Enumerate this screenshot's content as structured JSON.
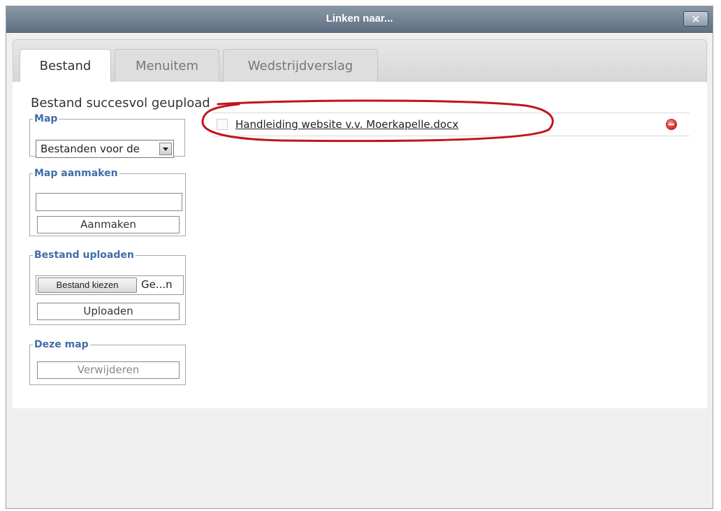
{
  "dialog": {
    "title": "Linken naar...",
    "close_glyph": "✕"
  },
  "tabs": [
    {
      "label": "Bestand",
      "active": true
    },
    {
      "label": "Menuitem",
      "active": false
    },
    {
      "label": "Wedstrijdverslag",
      "active": false
    }
  ],
  "status_message": "Bestand succesvol geupload",
  "map": {
    "legend": "Map",
    "selected": "Bestanden voor de"
  },
  "map_create": {
    "legend": "Map aanmaken",
    "input_value": "",
    "button_label": "Aanmaken"
  },
  "upload": {
    "legend": "Bestand uploaden",
    "choose_label": "Bestand kiezen",
    "file_name": "Ge...n",
    "button_label": "Uploaden"
  },
  "this_folder": {
    "legend": "Deze map",
    "button_label": "Verwijderen"
  },
  "files": [
    {
      "name": "Handleiding website v.v. Moerkapelle.docx"
    }
  ],
  "icons": {
    "remove": "remove-icon",
    "close": "close-icon",
    "dropdown": "chevron-down-icon"
  },
  "colors": {
    "legend": "#3f6ea6",
    "annotation": "#c0141c",
    "titlebar": "#6f7d8f"
  }
}
